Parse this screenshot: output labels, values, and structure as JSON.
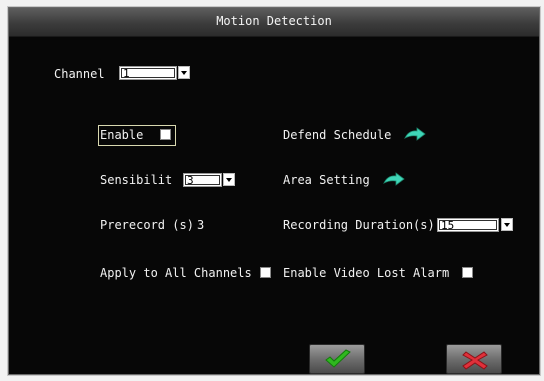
{
  "window": {
    "title": "Motion Detection"
  },
  "channel": {
    "label": "Channel",
    "value": "1"
  },
  "enable": {
    "label": "Enable",
    "checked": true
  },
  "sensitivity": {
    "label": "Sensibilit",
    "value": "3"
  },
  "prerecord": {
    "label": "Prerecord (s)",
    "value": "3"
  },
  "apply_all": {
    "label": "Apply to All Channels",
    "checked": false
  },
  "defend_schedule": {
    "label": "Defend Schedule",
    "icon": "arrow-right-icon"
  },
  "area_setting": {
    "label": "Area Setting",
    "icon": "arrow-right-icon"
  },
  "recording_duration": {
    "label": "Recording Duration(s)",
    "value": "15"
  },
  "video_lost_alarm": {
    "label": "Enable Video Lost Alarm",
    "checked": false
  },
  "buttons": {
    "ok_icon": "checkmark-icon",
    "cancel_icon": "close-icon",
    "ok_color": "#2fb81f",
    "cancel_color": "#e0303a"
  }
}
